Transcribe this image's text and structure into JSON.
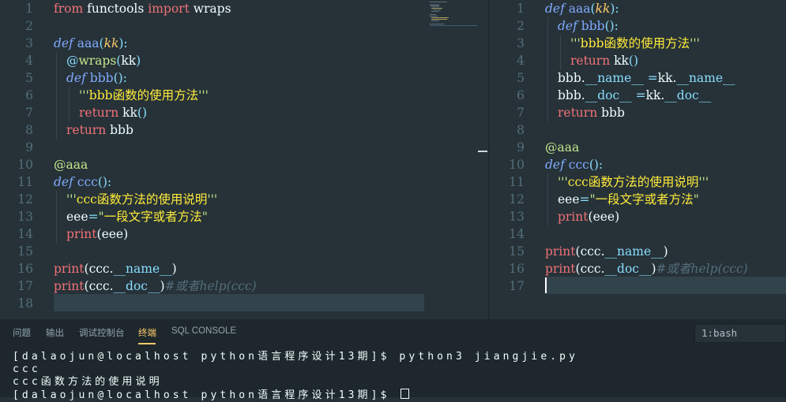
{
  "left_editor": {
    "line_numbers": [
      "1",
      "2",
      "3",
      "4",
      "5",
      "6",
      "7",
      "8",
      "9",
      "10",
      "11",
      "12",
      "13",
      "14",
      "15",
      "16",
      "17",
      "18"
    ],
    "l1": {
      "from": "from",
      "mod": "functools",
      "import": "import",
      "name": "wraps"
    },
    "l3": {
      "def": "def",
      "fn": "aaa",
      "p1": "(",
      "param": "kk",
      "p2": "):"
    },
    "l4": {
      "at": "@",
      "deco": "wraps",
      "p1": "(",
      "arg": "kk",
      "p2": ")"
    },
    "l5": {
      "def": "def",
      "fn": "bbb",
      "p": "():"
    },
    "l6": {
      "q1": "'''",
      "zh": "bbb函数的使用方法",
      "q2": "'''"
    },
    "l7": {
      "ret": "return",
      "call": "kk",
      "p": "()"
    },
    "l8": {
      "ret": "return",
      "val": "bbb"
    },
    "l10": {
      "deco": "@aaa"
    },
    "l11": {
      "def": "def",
      "fn": "ccc",
      "p": "():"
    },
    "l12": {
      "q1": "'''",
      "zh": "ccc函数方法的使用说明",
      "q2": "'''"
    },
    "l13": {
      "var": "eee",
      "eq": "=",
      "q1": "\"",
      "zh": "一段文字或者方法",
      "q2": "\""
    },
    "l14": {
      "fn": "print",
      "args": "(eee)"
    },
    "l16": {
      "fn": "print",
      "p1": "(ccc.",
      "dunder": "__name__",
      "p2": ")"
    },
    "l17": {
      "fn": "print",
      "p1": "(ccc.",
      "dunder": "__doc__",
      "p2": ")",
      "cmt": "#或者help(ccc)"
    }
  },
  "right_editor": {
    "line_numbers": [
      "1",
      "2",
      "3",
      "4",
      "5",
      "6",
      "7",
      "8",
      "9",
      "10",
      "11",
      "12",
      "13",
      "14",
      "15",
      "16",
      "17"
    ],
    "l1": {
      "def": "def",
      "fn": "aaa",
      "p1": "(",
      "param": "kk",
      "p2": "):"
    },
    "l2": {
      "def": "def",
      "fn": "bbb",
      "p": "():"
    },
    "l3": {
      "q1": "'''",
      "zh": "bbb函数的使用方法",
      "q2": "'''"
    },
    "l4": {
      "ret": "return",
      "call": "kk",
      "p": "()"
    },
    "l5": {
      "obj": "bbb.",
      "d1": "__name__",
      "eq": " =",
      "obj2": "kk.",
      "d2": "__name__"
    },
    "l6": {
      "obj": "bbb.",
      "d1": "__doc__",
      "eq": " =",
      "obj2": "kk.",
      "d2": "__doc__"
    },
    "l7": {
      "ret": "return",
      "val": "bbb"
    },
    "l9": {
      "deco": "@aaa"
    },
    "l10": {
      "def": "def",
      "fn": "ccc",
      "p": "():"
    },
    "l11": {
      "q1": "'''",
      "zh": "ccc函数方法的使用说明",
      "q2": "'''"
    },
    "l12": {
      "var": "eee",
      "eq": "=",
      "q1": "\"",
      "zh": "一段文字或者方法",
      "q2": "\""
    },
    "l13": {
      "fn": "print",
      "args": "(eee)"
    },
    "l15": {
      "fn": "print",
      "p1": "(ccc.",
      "dunder": "__name__",
      "p2": ")"
    },
    "l16": {
      "fn": "print",
      "p1": "(ccc.",
      "dunder": "__doc__",
      "p2": ")",
      "cmt": "#或者help(ccc)"
    }
  },
  "panel": {
    "tabs": [
      "问题",
      "输出",
      "调试控制台",
      "终端",
      "SQL CONSOLE"
    ],
    "active_tab": "终端",
    "terminal_select": "1:bash",
    "terminal_lines": [
      "[dalaojun@localhost python语言程序设计13期]$ python3 jiangjie.py",
      "ccc",
      "ccc函数方法的使用说明",
      "[dalaojun@localhost python语言程序设计13期]$ "
    ]
  },
  "colors": {
    "editor_bg": "#263238",
    "panel_bg": "#1e272c",
    "accent": "#ffcb6b",
    "keyword_def": "#82aaff",
    "keyword_return": "#f07178",
    "string_zh": "#ffeb3b"
  }
}
